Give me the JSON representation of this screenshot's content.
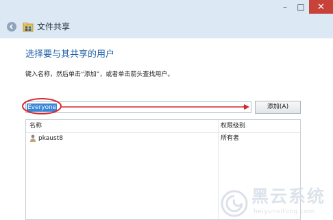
{
  "window": {
    "title": "文件共享",
    "controls": {
      "minimize": "–",
      "maximize": "□",
      "close": "✕"
    },
    "back_icon": "back-arrow-icon"
  },
  "dialog": {
    "heading": "选择要与其共享的用户",
    "instruction": "键入名称，然后单击“添加”，或者单击箭头查找用户。",
    "name_input_value": "Everyone",
    "add_button_label": "添加(A)"
  },
  "table": {
    "columns": [
      "名称",
      "权限级别"
    ],
    "rows": [
      {
        "user": "pkaust8",
        "permission": "所有者"
      }
    ]
  },
  "watermark": {
    "text": "黑云系统",
    "url": "heiyunxitong.com"
  },
  "colors": {
    "accent": "#1f5fa8",
    "annotation": "#d7262c",
    "close": "#c7433a",
    "selection": "#3a86d8"
  }
}
